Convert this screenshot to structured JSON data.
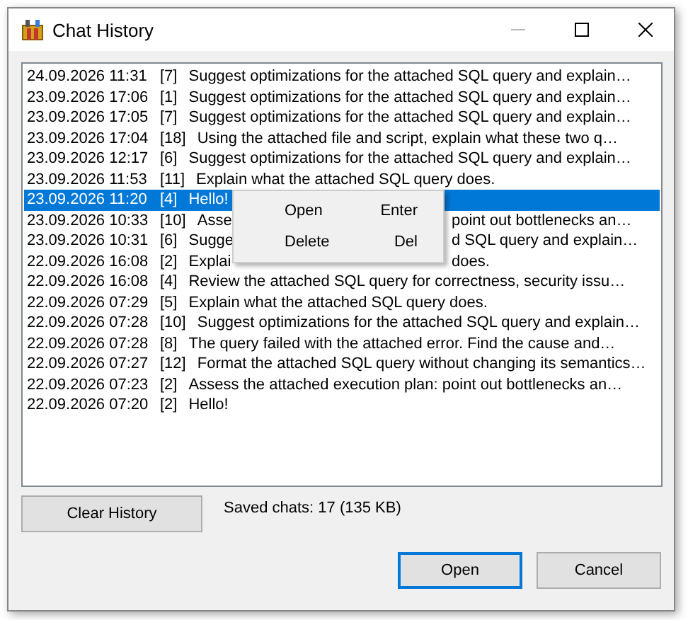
{
  "window": {
    "title": "Chat History"
  },
  "rows": [
    {
      "date": "24.09.2026 11:31",
      "count": "[7]",
      "message": "Suggest optimizations for the attached SQL query and explain…",
      "selected": false
    },
    {
      "date": "23.09.2026 17:06",
      "count": "[1]",
      "message": "Suggest optimizations for the attached SQL query and explain…",
      "selected": false
    },
    {
      "date": "23.09.2026 17:05",
      "count": "[7]",
      "message": "Suggest optimizations for the attached SQL query and explain…",
      "selected": false
    },
    {
      "date": "23.09.2026 17:04",
      "count": "[18]",
      "message": "Using the attached file and script, explain what these two q…",
      "selected": false
    },
    {
      "date": "23.09.2026 12:17",
      "count": "[6]",
      "message": "Suggest optimizations for the attached SQL query and explain…",
      "selected": false
    },
    {
      "date": "23.09.2026 11:53",
      "count": "[11]",
      "message": "Explain what the attached SQL query does.",
      "selected": false
    },
    {
      "date": "23.09.2026 11:20",
      "count": "[4]",
      "message": "Hello!",
      "selected": true
    },
    {
      "date": "23.09.2026 10:33",
      "count": "[10]",
      "visible_parts": [
        "Asse",
        "point out bottlenecks an…"
      ],
      "selected": false
    },
    {
      "date": "23.09.2026 10:31",
      "count": "[6]",
      "visible_parts": [
        "Sugge",
        "d SQL query and explain…"
      ],
      "selected": false
    },
    {
      "date": "22.09.2026 16:08",
      "count": "[2]",
      "visible_parts": [
        "Explai",
        "does."
      ],
      "selected": false
    },
    {
      "date": "22.09.2026 16:08",
      "count": "[4]",
      "message": "Review the attached SQL query for correctness, security issu…",
      "selected": false
    },
    {
      "date": "22.09.2026 07:29",
      "count": "[5]",
      "message": "Explain what the attached SQL query does.",
      "selected": false
    },
    {
      "date": "22.09.2026 07:28",
      "count": "[10]",
      "message": "Suggest optimizations for the attached SQL query and explain…",
      "selected": false
    },
    {
      "date": "22.09.2026 07:28",
      "count": "[8]",
      "message": "The query failed with the attached error. Find the cause and…",
      "selected": false
    },
    {
      "date": "22.09.2026 07:27",
      "count": "[12]",
      "message": "Format the attached SQL query without changing its semantics…",
      "selected": false
    },
    {
      "date": "22.09.2026 07:23",
      "count": "[2]",
      "message": "Assess the attached execution plan: point out bottlenecks an…",
      "selected": false
    },
    {
      "date": "22.09.2026 07:20",
      "count": "[2]",
      "message": "Hello!",
      "selected": false
    }
  ],
  "context_menu": [
    {
      "label": "Open",
      "shortcut": "Enter"
    },
    {
      "label": "Delete",
      "shortcut": "Del"
    }
  ],
  "clear_button": "Clear History",
  "status": "Saved chats: 17 (135 KB)",
  "buttons": [
    {
      "label": "Open",
      "default": true
    },
    {
      "label": "Cancel",
      "default": false
    }
  ]
}
